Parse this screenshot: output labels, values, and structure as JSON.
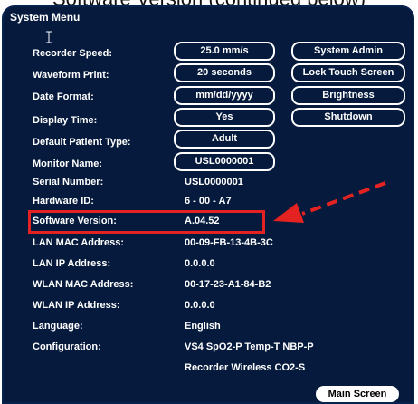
{
  "top_crop_text": "Software Version (continued below)",
  "window": {
    "title": "System Menu"
  },
  "rows": [
    {
      "label": "Recorder Speed:",
      "value": "25.0 mm/s"
    },
    {
      "label": "Waveform Print:",
      "value": "20 seconds"
    },
    {
      "label": "Date Format:",
      "value": "mm/dd/yyyy"
    },
    {
      "label": "Display Time:",
      "value": "Yes"
    },
    {
      "label": "Default Patient Type:",
      "value": "Adult"
    },
    {
      "label": "Monitor Name:",
      "value": "USL0000001"
    },
    {
      "label": "Serial Number:",
      "value": "USL0000001"
    },
    {
      "label": "Hardware ID:",
      "value": "6 - 00 - A7"
    },
    {
      "label": "Software Version:",
      "value": "A.04.52"
    },
    {
      "label": "LAN MAC Address:",
      "value": "00-09-FB-13-4B-3C"
    },
    {
      "label": "LAN IP Address:",
      "value": "0.0.0.0"
    },
    {
      "label": "WLAN MAC Address:",
      "value": "00-17-23-A1-84-B2"
    },
    {
      "label": "WLAN IP Address:",
      "value": "0.0.0.0"
    },
    {
      "label": "Language:",
      "value": "English"
    },
    {
      "label": "Configuration:",
      "value": "VS4 SpO2-P Temp-T NBP-P"
    },
    {
      "label": "",
      "value": "Recorder Wireless CO2-S"
    }
  ],
  "side_buttons": [
    "System Admin",
    "Lock Touch Screen",
    "Brightness",
    "Shutdown"
  ],
  "main_screen_button": "Main Screen",
  "annotation": {
    "highlight_color": "#e42222",
    "highlighted_row": "Software Version:"
  },
  "colors": {
    "panel_background": "#051a3c",
    "text": "#ffffff"
  }
}
